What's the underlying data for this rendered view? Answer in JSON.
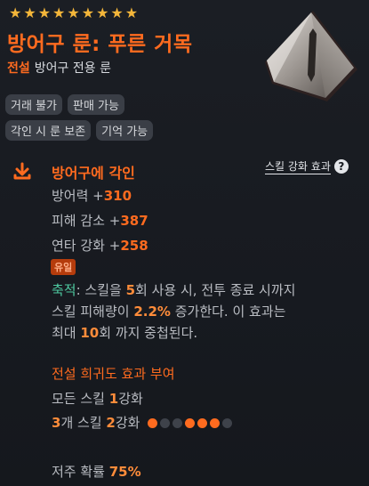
{
  "item": {
    "stars": 9,
    "name": "방어구 룬: 푸른 거목",
    "grade": "전설",
    "category": "방어구 전용 룬",
    "tags": [
      [
        "거래 불가",
        "판매 가능"
      ],
      [
        "각인 시 룬 보존",
        "기억 가능"
      ]
    ]
  },
  "section": {
    "title": "방어구에 각인",
    "help_label": "스킬 강화 효과",
    "help_icon": "question-icon"
  },
  "stats": [
    {
      "label": "방어력 ",
      "plus": "+",
      "value": "310"
    },
    {
      "label": "피해 감소 ",
      "plus": "+",
      "value": "387"
    },
    {
      "label": "연타 강화 ",
      "plus": "+",
      "value": "258"
    }
  ],
  "unique_badge": "유일",
  "effect": {
    "keyword": "축적",
    "t1": ": 스킬을 ",
    "n1": "5",
    "t2": "회 사용 시, 전투 종료 시까지",
    "t3": "스킬 피해량이 ",
    "n2": "2.2%",
    "t4": " 증가한다. 이 효과는",
    "t5": "최대 ",
    "n3": "10",
    "t6": "회 까지 중첩된다."
  },
  "set": {
    "title": "전설 희귀도 효과 부여",
    "line1_a": "모든 스킬 ",
    "line1_n": "1",
    "line1_b": "강화",
    "line2_n1": "3",
    "line2_a": "개 스킬 ",
    "line2_n2": "2",
    "line2_b": "강화",
    "dots": [
      true,
      false,
      false,
      true,
      true,
      true,
      false
    ]
  },
  "curse": {
    "label": "저주 확률 ",
    "value": "75%"
  },
  "colors": {
    "accent": "#ff6b1f",
    "keyword": "#4ec9a0",
    "star": "#f4b63a"
  }
}
